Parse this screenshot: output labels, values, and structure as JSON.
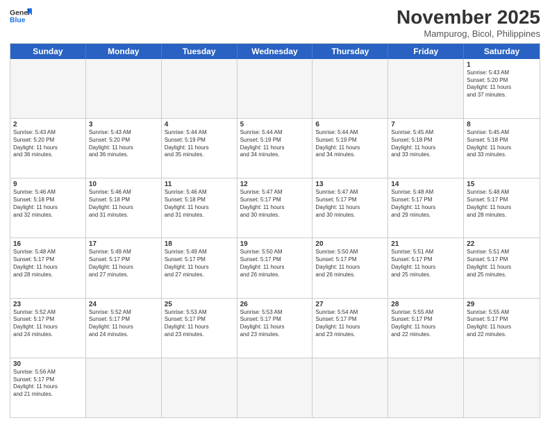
{
  "header": {
    "logo_general": "General",
    "logo_blue": "Blue",
    "month_title": "November 2025",
    "location": "Mampurog, Bicol, Philippines"
  },
  "days_of_week": [
    "Sunday",
    "Monday",
    "Tuesday",
    "Wednesday",
    "Thursday",
    "Friday",
    "Saturday"
  ],
  "weeks": [
    [
      {
        "day": "",
        "info": ""
      },
      {
        "day": "",
        "info": ""
      },
      {
        "day": "",
        "info": ""
      },
      {
        "day": "",
        "info": ""
      },
      {
        "day": "",
        "info": ""
      },
      {
        "day": "",
        "info": ""
      },
      {
        "day": "1",
        "info": "Sunrise: 5:43 AM\nSunset: 5:20 PM\nDaylight: 11 hours\nand 37 minutes."
      }
    ],
    [
      {
        "day": "2",
        "info": "Sunrise: 5:43 AM\nSunset: 5:20 PM\nDaylight: 11 hours\nand 36 minutes."
      },
      {
        "day": "3",
        "info": "Sunrise: 5:43 AM\nSunset: 5:20 PM\nDaylight: 11 hours\nand 36 minutes."
      },
      {
        "day": "4",
        "info": "Sunrise: 5:44 AM\nSunset: 5:19 PM\nDaylight: 11 hours\nand 35 minutes."
      },
      {
        "day": "5",
        "info": "Sunrise: 5:44 AM\nSunset: 5:19 PM\nDaylight: 11 hours\nand 34 minutes."
      },
      {
        "day": "6",
        "info": "Sunrise: 5:44 AM\nSunset: 5:19 PM\nDaylight: 11 hours\nand 34 minutes."
      },
      {
        "day": "7",
        "info": "Sunrise: 5:45 AM\nSunset: 5:18 PM\nDaylight: 11 hours\nand 33 minutes."
      },
      {
        "day": "8",
        "info": "Sunrise: 5:45 AM\nSunset: 5:18 PM\nDaylight: 11 hours\nand 33 minutes."
      }
    ],
    [
      {
        "day": "9",
        "info": "Sunrise: 5:46 AM\nSunset: 5:18 PM\nDaylight: 11 hours\nand 32 minutes."
      },
      {
        "day": "10",
        "info": "Sunrise: 5:46 AM\nSunset: 5:18 PM\nDaylight: 11 hours\nand 31 minutes."
      },
      {
        "day": "11",
        "info": "Sunrise: 5:46 AM\nSunset: 5:18 PM\nDaylight: 11 hours\nand 31 minutes."
      },
      {
        "day": "12",
        "info": "Sunrise: 5:47 AM\nSunset: 5:17 PM\nDaylight: 11 hours\nand 30 minutes."
      },
      {
        "day": "13",
        "info": "Sunrise: 5:47 AM\nSunset: 5:17 PM\nDaylight: 11 hours\nand 30 minutes."
      },
      {
        "day": "14",
        "info": "Sunrise: 5:48 AM\nSunset: 5:17 PM\nDaylight: 11 hours\nand 29 minutes."
      },
      {
        "day": "15",
        "info": "Sunrise: 5:48 AM\nSunset: 5:17 PM\nDaylight: 11 hours\nand 28 minutes."
      }
    ],
    [
      {
        "day": "16",
        "info": "Sunrise: 5:48 AM\nSunset: 5:17 PM\nDaylight: 11 hours\nand 28 minutes."
      },
      {
        "day": "17",
        "info": "Sunrise: 5:49 AM\nSunset: 5:17 PM\nDaylight: 11 hours\nand 27 minutes."
      },
      {
        "day": "18",
        "info": "Sunrise: 5:49 AM\nSunset: 5:17 PM\nDaylight: 11 hours\nand 27 minutes."
      },
      {
        "day": "19",
        "info": "Sunrise: 5:50 AM\nSunset: 5:17 PM\nDaylight: 11 hours\nand 26 minutes."
      },
      {
        "day": "20",
        "info": "Sunrise: 5:50 AM\nSunset: 5:17 PM\nDaylight: 11 hours\nand 26 minutes."
      },
      {
        "day": "21",
        "info": "Sunrise: 5:51 AM\nSunset: 5:17 PM\nDaylight: 11 hours\nand 25 minutes."
      },
      {
        "day": "22",
        "info": "Sunrise: 5:51 AM\nSunset: 5:17 PM\nDaylight: 11 hours\nand 25 minutes."
      }
    ],
    [
      {
        "day": "23",
        "info": "Sunrise: 5:52 AM\nSunset: 5:17 PM\nDaylight: 11 hours\nand 24 minutes."
      },
      {
        "day": "24",
        "info": "Sunrise: 5:52 AM\nSunset: 5:17 PM\nDaylight: 11 hours\nand 24 minutes."
      },
      {
        "day": "25",
        "info": "Sunrise: 5:53 AM\nSunset: 5:17 PM\nDaylight: 11 hours\nand 23 minutes."
      },
      {
        "day": "26",
        "info": "Sunrise: 5:53 AM\nSunset: 5:17 PM\nDaylight: 11 hours\nand 23 minutes."
      },
      {
        "day": "27",
        "info": "Sunrise: 5:54 AM\nSunset: 5:17 PM\nDaylight: 11 hours\nand 23 minutes."
      },
      {
        "day": "28",
        "info": "Sunrise: 5:55 AM\nSunset: 5:17 PM\nDaylight: 11 hours\nand 22 minutes."
      },
      {
        "day": "29",
        "info": "Sunrise: 5:55 AM\nSunset: 5:17 PM\nDaylight: 11 hours\nand 22 minutes."
      }
    ],
    [
      {
        "day": "30",
        "info": "Sunrise: 5:56 AM\nSunset: 5:17 PM\nDaylight: 11 hours\nand 21 minutes."
      },
      {
        "day": "",
        "info": ""
      },
      {
        "day": "",
        "info": ""
      },
      {
        "day": "",
        "info": ""
      },
      {
        "day": "",
        "info": ""
      },
      {
        "day": "",
        "info": ""
      },
      {
        "day": "",
        "info": ""
      }
    ]
  ]
}
